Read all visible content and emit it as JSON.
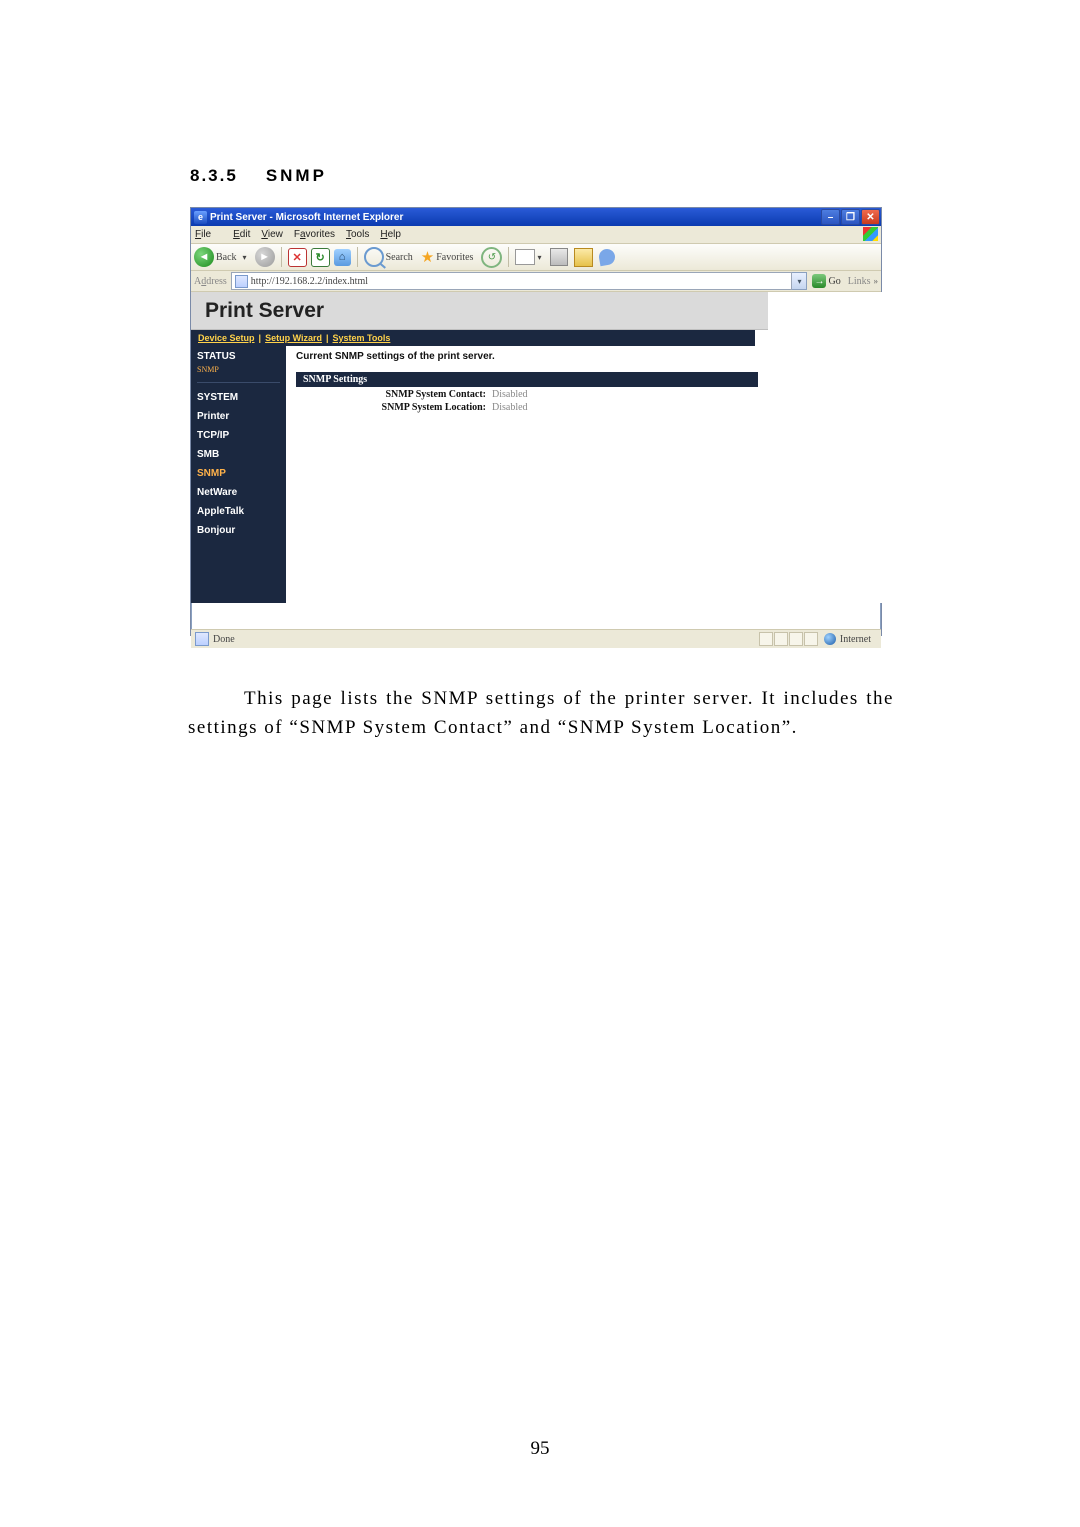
{
  "heading": {
    "number": "8.3.5",
    "title": "SNMP"
  },
  "window": {
    "title": "Print Server - Microsoft Internet Explorer",
    "minimize": "–",
    "maximize": "❐",
    "close": "✕",
    "menu": {
      "file": "File",
      "edit": "Edit",
      "view": "View",
      "favorites": "Favorites",
      "tools": "Tools",
      "help": "Help"
    },
    "toolbar": {
      "back": "Back",
      "search": "Search",
      "favorites": "Favorites"
    },
    "address": {
      "label": "Address",
      "url": "http://192.168.2.2/index.html",
      "go": "Go",
      "links": "Links"
    },
    "banner": "Print Server",
    "tabs": {
      "device": "Device Setup",
      "wizard": "Setup Wizard",
      "tools": "System Tools"
    },
    "sidebar": {
      "status": "STATUS",
      "status_sub": "SNMP",
      "system": "SYSTEM",
      "printer": "Printer",
      "tcpip": "TCP/IP",
      "smb": "SMB",
      "snmp": "SNMP",
      "netware": "NetWare",
      "appletalk": "AppleTalk",
      "bonjour": "Bonjour"
    },
    "content": {
      "desc": "Current SNMP settings of the print server.",
      "settings_hdr": "SNMP Settings",
      "contact_k": "SNMP System Contact:",
      "contact_v": "Disabled",
      "location_k": "SNMP System Location:",
      "location_v": "Disabled"
    },
    "status": {
      "done": "Done",
      "zone": "Internet"
    }
  },
  "body_text": "This page lists the SNMP settings of the printer server. It includes the settings of “SNMP System Contact” and “SNMP System Location”.",
  "page_number": "95"
}
